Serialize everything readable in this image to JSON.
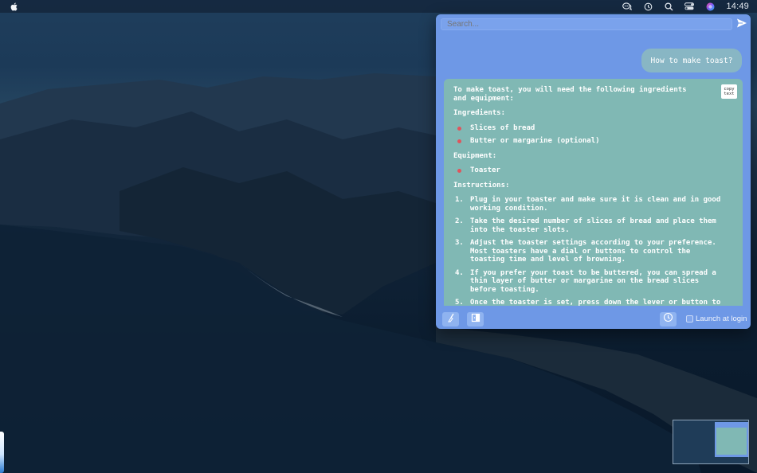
{
  "menubar": {
    "apple_icon": "apple-logo-icon",
    "status_icons": [
      "chat-bubbles-icon",
      "time-machine-icon",
      "spotlight-search-icon",
      "control-center-icon",
      "siri-icon"
    ],
    "clock": "14:49"
  },
  "app": {
    "search": {
      "placeholder": "Search..."
    },
    "send_icon": "send-icon",
    "user_message": "How to make toast?",
    "copy_button": {
      "line1": "copy",
      "line2": "text"
    },
    "answer": {
      "intro": "To make toast, you will need the following ingredients and equipment:",
      "ingredients_heading": "Ingredients:",
      "ingredients": [
        "Slices of bread",
        "Butter or margarine (optional)"
      ],
      "equipment_heading": "Equipment:",
      "equipment": [
        "Toaster"
      ],
      "instructions_heading": "Instructions:",
      "instructions": [
        {
          "num": "1.",
          "text": "Plug in your toaster and make sure it is clean and in good working condition."
        },
        {
          "num": "2.",
          "text": "Take the desired number of slices of bread and place them into the toaster slots."
        },
        {
          "num": "3.",
          "text": "Adjust the toaster settings according to your preference. Most toasters have a dial or buttons to control the toasting time and level of browning."
        },
        {
          "num": "4.",
          "text": "If you prefer your toast to be buttered, you can spread a thin layer of butter or margarine on the bread slices before toasting."
        },
        {
          "num": "5.",
          "text": "Once the toaster is set, press down the lever or button to"
        }
      ]
    },
    "bottom": {
      "broom_icon": "clear-chat-icon",
      "exit_icon": "quit-icon",
      "history_icon": "history-icon",
      "launch_label": "Launch at login",
      "launch_checked": false
    }
  },
  "colors": {
    "panel": "#6e98e6",
    "answer_bubble": "#80b8b4",
    "user_bubble": "#88b6c4",
    "bullet": "#e0545c"
  }
}
